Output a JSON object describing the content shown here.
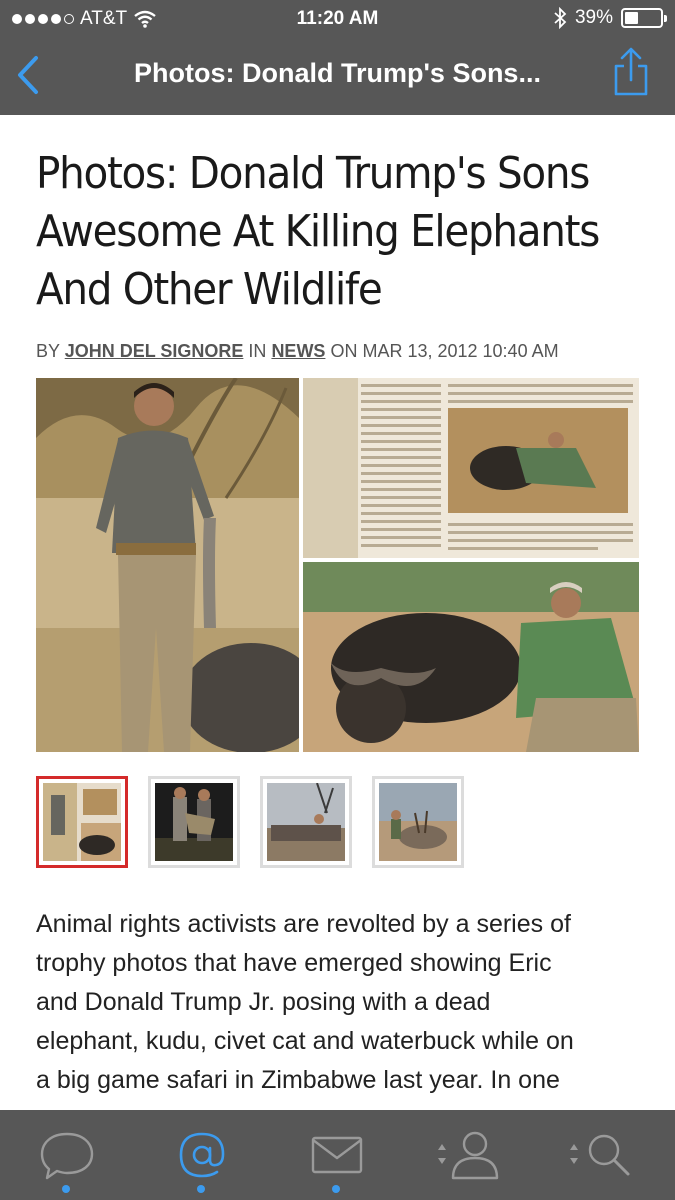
{
  "status_bar": {
    "carrier": "AT&T",
    "time": "11:20 AM",
    "battery": "39%",
    "battery_level": 0.39,
    "signal_bars": 4,
    "signal_total": 5
  },
  "nav": {
    "title": "Photos: Donald Trump's Sons...",
    "back_icon": "chevron-left-icon",
    "share_icon": "share-icon",
    "accent": "#3c9bee",
    "bar_color": "#575757"
  },
  "article": {
    "headline_lines": [
      "Photos: Donald Trump's Sons",
      "Awesome At Killing Elephants",
      "And Other Wildlife"
    ],
    "byline": {
      "by": "BY",
      "author": "JOHN DEL SIGNORE",
      "in": "IN",
      "section": "NEWS",
      "on": "ON",
      "date": "MAR 13, 2012 10:40 AM"
    },
    "thumbnails_count": 4,
    "active_thumbnail": 1,
    "active_color": "#d42a2a",
    "body_lines": [
      "Animal rights activists are revolted by a series of",
      "trophy photos that have emerged showing Eric",
      "and Donald Trump Jr. posing with a dead",
      "elephant, kudu, civet cat and waterbuck while on",
      "a big game safari in Zimbabwe last year. In one"
    ]
  },
  "tabbar": {
    "tabs": [
      {
        "icon": "speech-bubble-icon",
        "active": false
      },
      {
        "icon": "at-sign-icon",
        "active": true
      },
      {
        "icon": "envelope-icon",
        "active": false
      },
      {
        "icon": "person-icon",
        "active": false
      },
      {
        "icon": "search-icon",
        "active": false
      }
    ]
  }
}
